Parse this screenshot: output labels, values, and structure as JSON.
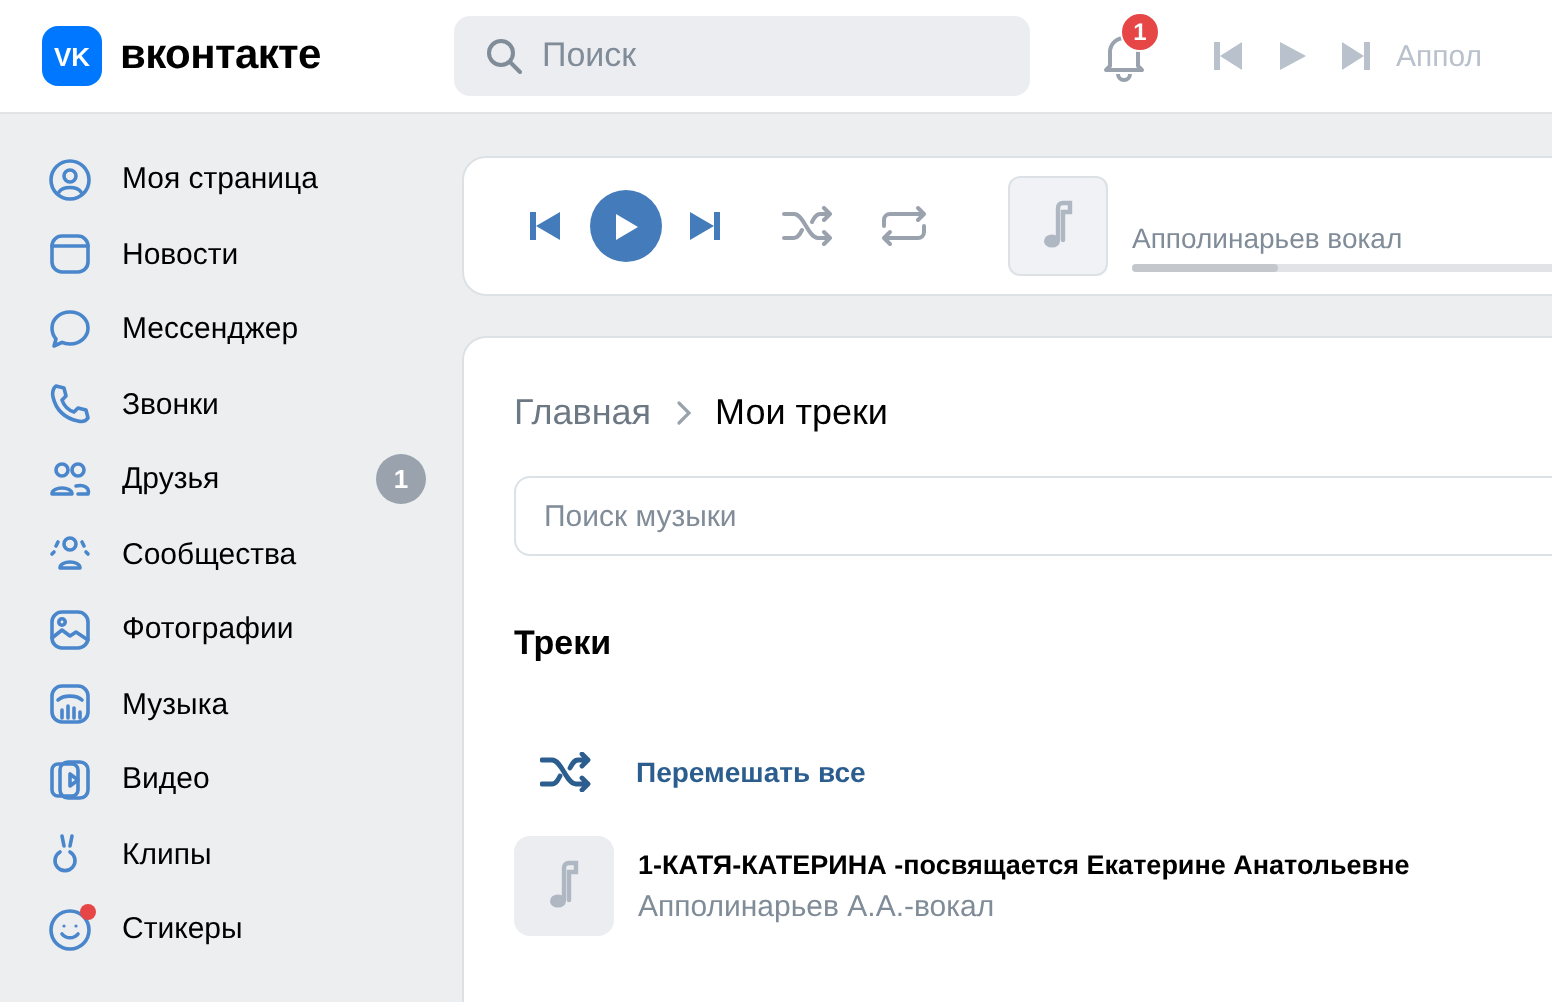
{
  "header": {
    "logo_mark": "VK",
    "logo_text": "вконтакте",
    "search": {
      "placeholder": "Поиск"
    },
    "notifications": {
      "count": "1"
    },
    "mini_player": {
      "title": "Аппол",
      "disabled": true
    }
  },
  "sidebar": {
    "items": [
      {
        "label": "Моя страница",
        "dot": false
      },
      {
        "label": "Новости",
        "dot": false
      },
      {
        "label": "Мессенджер",
        "dot": false
      },
      {
        "label": "Звонки",
        "dot": false
      },
      {
        "label": "Друзья",
        "dot": false,
        "badge": "1"
      },
      {
        "label": "Сообщества",
        "dot": false
      },
      {
        "label": "Фотографии",
        "dot": false
      },
      {
        "label": "Музыка",
        "dot": false
      },
      {
        "label": "Видео",
        "dot": false
      },
      {
        "label": "Клипы",
        "dot": false
      },
      {
        "label": "Стикеры",
        "dot": true
      }
    ]
  },
  "player": {
    "playing": false,
    "shuffle": false,
    "repeat": false,
    "title": "Апполинарьев вокал",
    "level": 0.3
  },
  "main": {
    "breadcrumb": [
      {
        "label": "Главная",
        "current": false
      },
      {
        "label": "Мои треки",
        "current": true
      }
    ],
    "search": {
      "placeholder": "Поиск музыки"
    },
    "section_title": "Треки",
    "shuffle_all": "Перемешать все",
    "tracks": [
      {
        "title": "1-КАТЯ-КАТЕРИНА -посвящается Екатерине Анатольевне",
        "artist": "Апполинарьев А.А.-вокал"
      }
    ]
  }
}
